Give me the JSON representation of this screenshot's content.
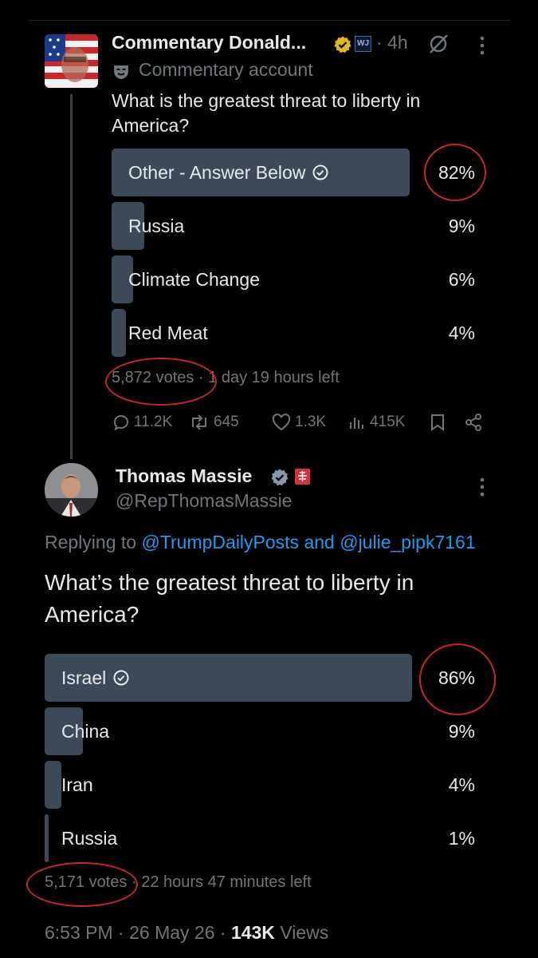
{
  "post1": {
    "author_name": "Commentary Donald...",
    "badge_label": "WJ",
    "time": "· 4h",
    "community_label": "Commentary account",
    "question": "What is the greatest threat to liberty in America?",
    "poll": [
      {
        "label": "Other - Answer Below",
        "percent": "82%",
        "share": 0.82,
        "winner": true
      },
      {
        "label": "Russia",
        "percent": "9%",
        "share": 0.09,
        "winner": false
      },
      {
        "label": "Climate Change",
        "percent": "6%",
        "share": 0.06,
        "winner": false
      },
      {
        "label": "Red Meat",
        "percent": "4%",
        "share": 0.04,
        "winner": false
      }
    ],
    "votes": "5,872 votes",
    "time_left": "· 1 day 19 hours left",
    "replies": "11.2K",
    "reposts": "645",
    "likes": "1.3K",
    "views": "415K"
  },
  "post2": {
    "author_name": "Thomas Massie",
    "handle": "@RepThomasMassie",
    "replying_prefix": "Replying to",
    "reply_to_1": "@TrumpDailyPosts",
    "reply_and": "and",
    "reply_to_2": "@julie_pipk7161",
    "question": "What’s the greatest threat to liberty in America?",
    "poll": [
      {
        "label": "Israel",
        "percent": "86%",
        "share": 0.86,
        "winner": true
      },
      {
        "label": "China",
        "percent": "9%",
        "share": 0.09,
        "winner": false
      },
      {
        "label": "Iran",
        "percent": "4%",
        "share": 0.04,
        "winner": false
      },
      {
        "label": "Russia",
        "percent": "1%",
        "share": 0.01,
        "winner": false
      }
    ],
    "votes": "5,171 votes",
    "time_left": "· 22 hours 47 minutes left",
    "timestamp": "6:53 PM · 26 May 26 ·",
    "view_count": "143K",
    "views_label": "Views"
  },
  "colors": {
    "background": "#000000",
    "bar": "#3c4a58",
    "muted": "#71767b",
    "link": "#1d9bf0",
    "annotation": "#c8232c",
    "verified_gold": "#e2b719"
  },
  "icons": [
    "verified-gold-icon",
    "grok-icon",
    "more-icon",
    "mask-icon",
    "reply-icon",
    "repost-icon",
    "like-icon",
    "views-icon",
    "bookmark-icon",
    "share-icon",
    "verified-gray-icon",
    "check-circle-icon"
  ]
}
